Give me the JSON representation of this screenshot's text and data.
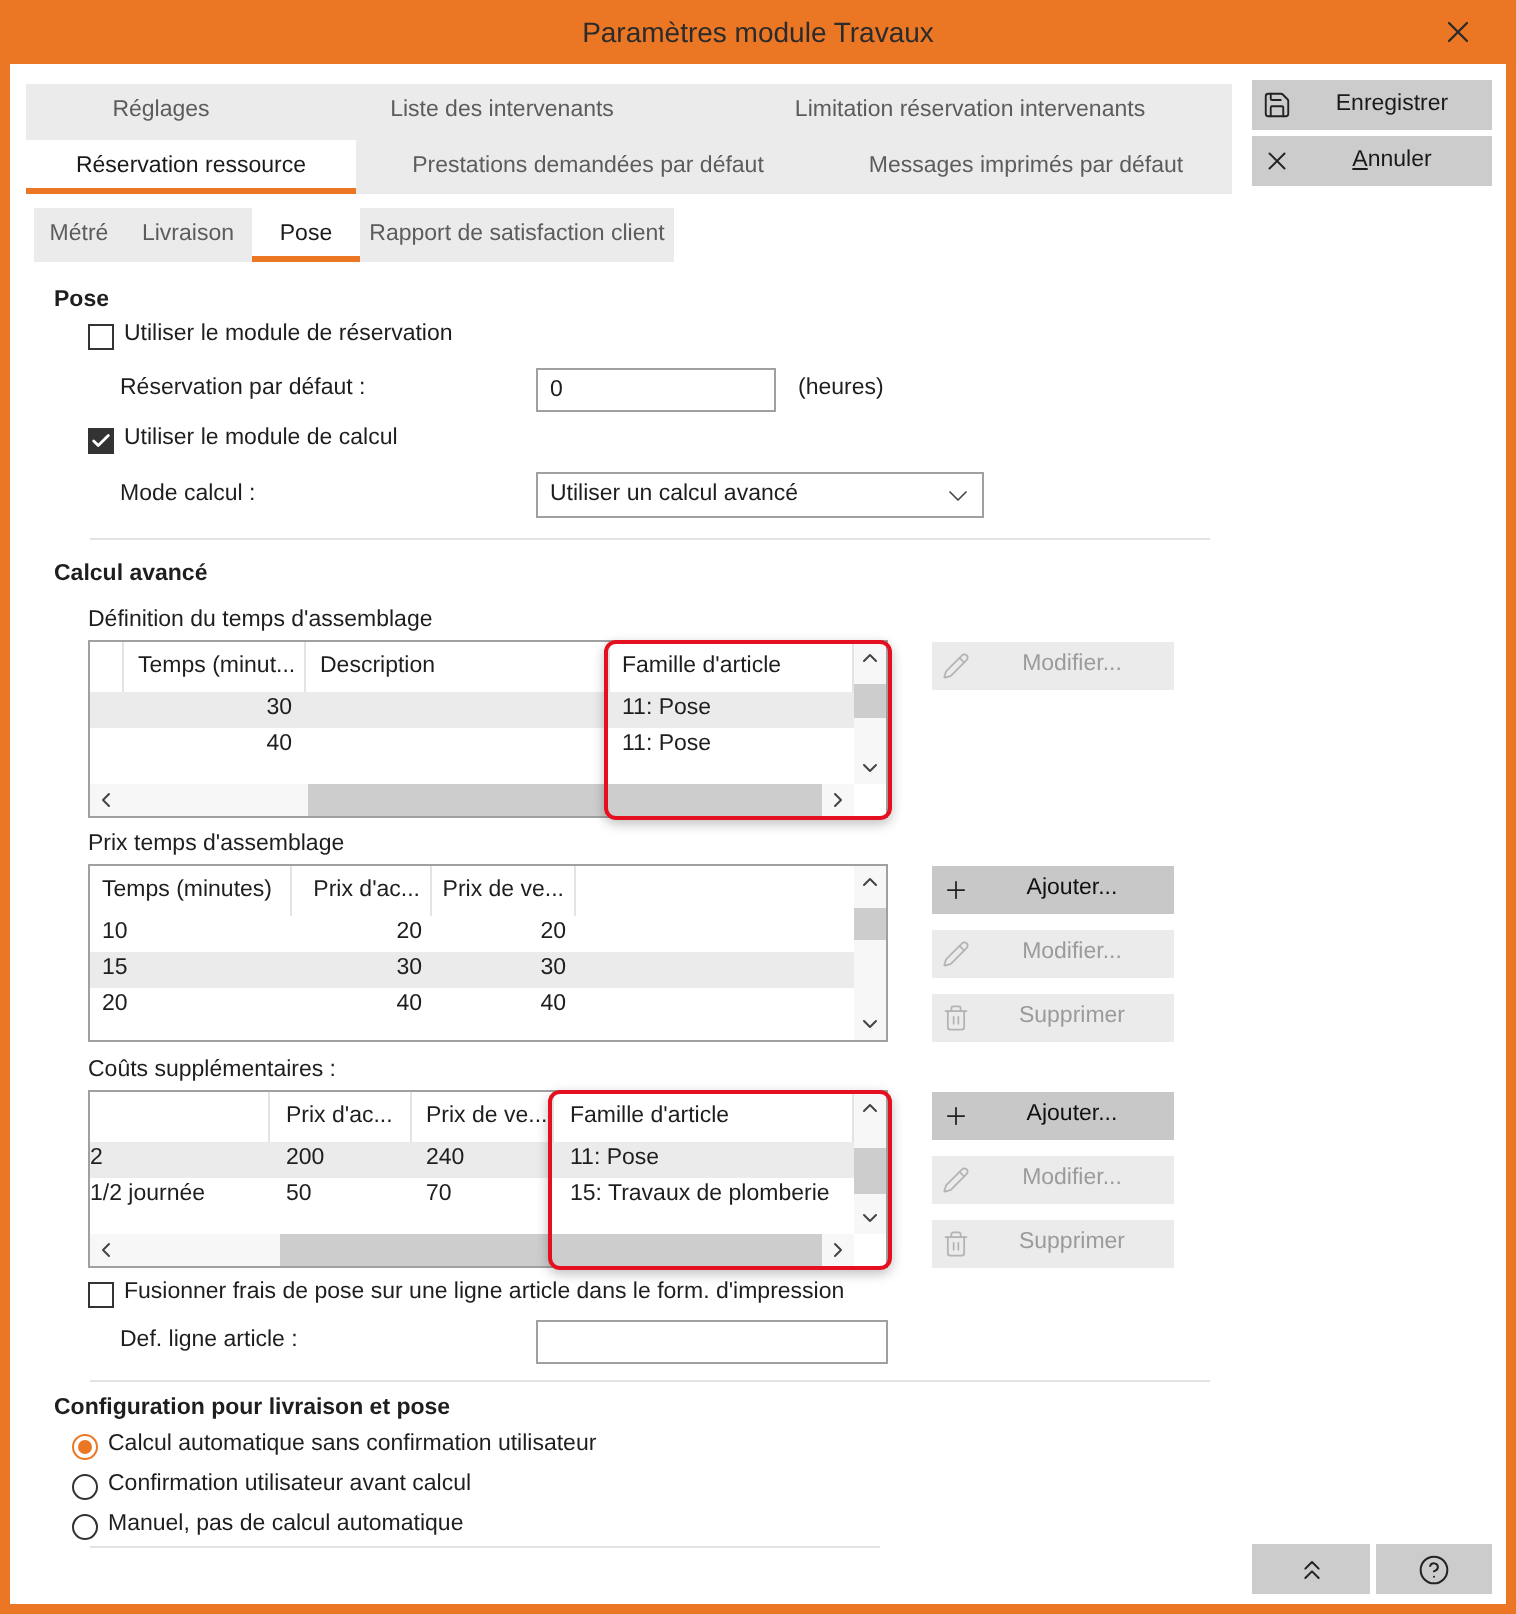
{
  "window": {
    "title": "Paramètres module Travaux"
  },
  "tab_rows": [
    {
      "tabs": [
        {
          "label": "Réglages",
          "selected": false
        },
        {
          "label": "Liste des intervenants",
          "selected": false
        },
        {
          "label": "Limitation réservation intervenants",
          "selected": false
        }
      ]
    },
    {
      "tabs": [
        {
          "label": "Réservation ressource",
          "selected": true
        },
        {
          "label": "Prestations demandées par défaut",
          "selected": false
        },
        {
          "label": "Messages imprimés par défaut",
          "selected": false
        }
      ]
    }
  ],
  "actions": [
    {
      "label": "Enregistrer",
      "kind": "save",
      "mnemonic": false
    },
    {
      "label": "Annuler",
      "kind": "cancel",
      "mnemonic": true
    }
  ],
  "subtabs": [
    {
      "label": "Métré",
      "selected": false
    },
    {
      "label": "Livraison",
      "selected": false
    },
    {
      "label": "Pose",
      "selected": true
    },
    {
      "label": "Rapport de satisfaction client",
      "selected": false
    }
  ],
  "pose": {
    "heading": "Pose",
    "use_reservation": {
      "label": "Utiliser le module de réservation",
      "checked": false
    },
    "default_reservation": {
      "label": "Réservation par défaut :",
      "value": "0",
      "unit": "(heures)"
    },
    "use_calculation": {
      "label": "Utiliser le module de calcul",
      "checked": true
    },
    "calculation_mode": {
      "label": "Mode calcul :",
      "value": "Utiliser un calcul avancé"
    }
  },
  "advanced": {
    "heading": "Calcul avancé",
    "tables": [
      {
        "title": "Définition du temps d'assemblage",
        "horizontal_scrollbar": true,
        "columns": [
          {
            "label": "Temps (minut...",
            "highlighted": false
          },
          {
            "label": "Description",
            "highlighted": false
          },
          {
            "label": "Famille d'article",
            "highlighted": true
          }
        ],
        "rows": [
          {
            "cells": [
              "30",
              null,
              "11: Pose"
            ],
            "shaded": true
          },
          {
            "cells": [
              "40",
              null,
              "11: Pose"
            ],
            "shaded": false
          }
        ],
        "buttons": [
          {
            "label": "Modifier...",
            "kind": "edit",
            "disabled": true
          }
        ]
      },
      {
        "title": "Prix temps d'assemblage",
        "horizontal_scrollbar": false,
        "columns": [
          {
            "label": "Temps (minutes)",
            "highlighted": false
          },
          {
            "label": "Prix d'ac...",
            "highlighted": false
          },
          {
            "label": "Prix de ve...",
            "highlighted": false
          }
        ],
        "rows": [
          {
            "cells": [
              "10",
              "20",
              "20"
            ],
            "shaded": false
          },
          {
            "cells": [
              "15",
              "30",
              "30"
            ],
            "shaded": true
          },
          {
            "cells": [
              "20",
              "40",
              "40"
            ],
            "shaded": false
          }
        ],
        "buttons": [
          {
            "label": "Ajouter...",
            "kind": "add",
            "disabled": false
          },
          {
            "label": "Modifier...",
            "kind": "edit",
            "disabled": true
          },
          {
            "label": "Supprimer",
            "kind": "delete",
            "disabled": true
          }
        ]
      },
      {
        "title": "Coûts supplémentaires :",
        "horizontal_scrollbar": true,
        "columns": [
          {
            "highlighted": false
          },
          {
            "label": "Prix d'ac...",
            "highlighted": false
          },
          {
            "label": "Prix de ve...",
            "highlighted": false
          },
          {
            "label": "Famille d'article",
            "highlighted": true
          }
        ],
        "rows": [
          {
            "cells": [
              "2",
              "200",
              "240",
              "11: Pose"
            ],
            "shaded": true
          },
          {
            "cells": [
              "1/2 journée",
              "50",
              "70",
              "15: Travaux de plomberie"
            ],
            "shaded": false
          }
        ],
        "buttons": [
          {
            "label": "Ajouter...",
            "kind": "add",
            "disabled": false
          },
          {
            "label": "Modifier...",
            "kind": "edit",
            "disabled": true
          },
          {
            "label": "Supprimer",
            "kind": "delete",
            "disabled": true
          }
        ]
      }
    ],
    "merge_fees": {
      "label": "Fusionner frais de pose sur une ligne article dans le form. d'impression",
      "checked": false
    },
    "article_line": {
      "label": "Def. ligne article :"
    }
  },
  "configuration": {
    "heading": "Configuration pour livraison et pose",
    "options": [
      {
        "label": "Calcul automatique sans confirmation utilisateur",
        "selected": true
      },
      {
        "label": "Confirmation utilisateur avant calcul",
        "selected": false
      },
      {
        "label": "Manuel, pas de calcul automatique",
        "selected": false
      }
    ]
  }
}
